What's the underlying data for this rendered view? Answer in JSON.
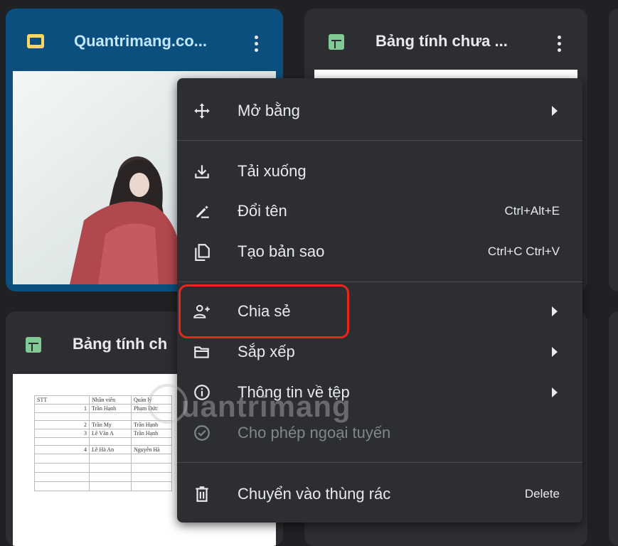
{
  "cards": [
    {
      "title": "Quantrimang.co..."
    },
    {
      "title": "Bảng tính chưa ..."
    },
    {
      "title": "Bảng tính ch"
    }
  ],
  "sheet_preview": {
    "headers": [
      "STT",
      "Nhân viên",
      "Quản lý"
    ],
    "rows": [
      [
        "1",
        "Trần Hạnh",
        "Phạm Đức"
      ],
      [
        "2",
        "Trần My",
        "Trần Hạnh"
      ],
      [
        "3",
        "Lê Văn A",
        "Trần Hạnh"
      ],
      [
        "4",
        "Lê Hà An",
        "Nguyễn Hà"
      ]
    ]
  },
  "menu": {
    "open_with": "Mở bằng",
    "download": "Tải xuống",
    "rename": "Đổi tên",
    "rename_shortcut": "Ctrl+Alt+E",
    "make_copy": "Tạo bản sao",
    "make_copy_shortcut": "Ctrl+C Ctrl+V",
    "share": "Chia sẻ",
    "organize": "Sắp xếp",
    "file_info": "Thông tin về tệp",
    "offline": "Cho phép ngoại tuyến",
    "trash": "Chuyển vào thùng rác",
    "trash_shortcut": "Delete"
  },
  "watermark": "uantrimang",
  "colors": {
    "selected_card": "#0b4f7e",
    "highlight_border": "#e8261d",
    "sheets_green": "#81c995",
    "slides_yellow": "#fdd663"
  }
}
